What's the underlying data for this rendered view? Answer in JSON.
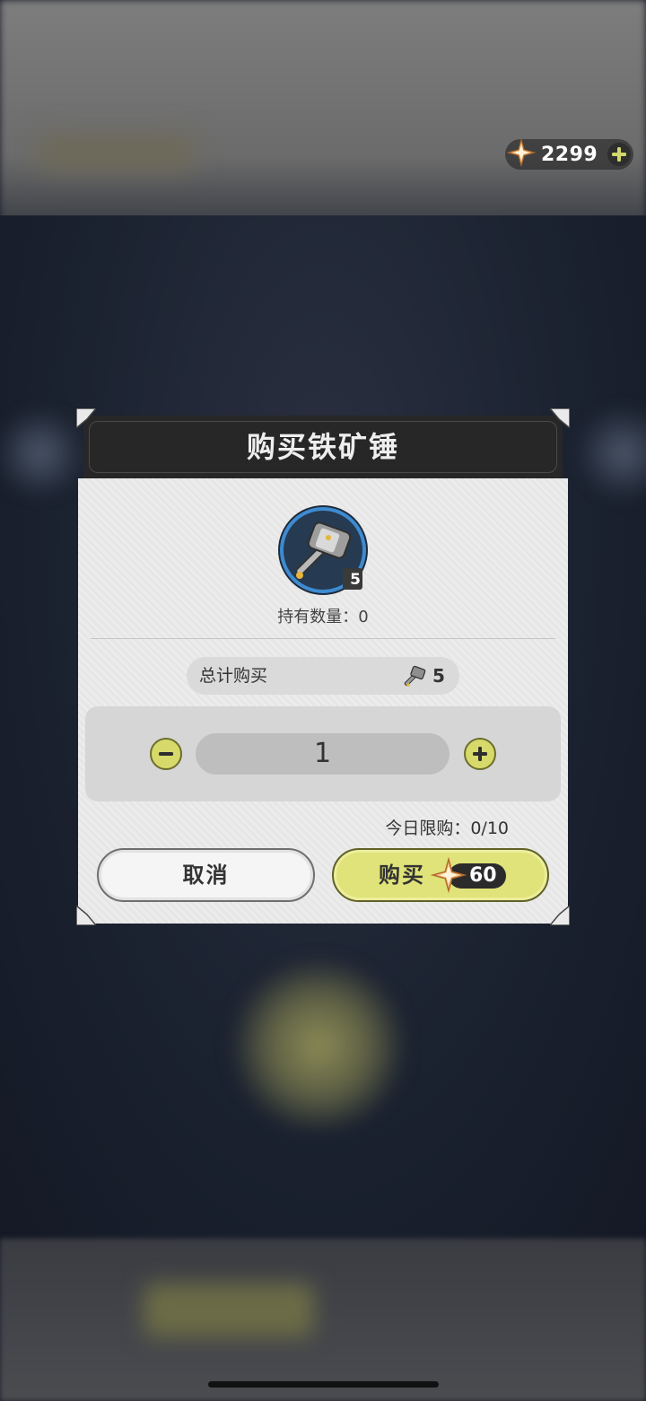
{
  "currency": {
    "value": "2299",
    "icon": "primogem-star-icon",
    "add_icon": "plus-icon"
  },
  "dialog": {
    "title": "购买铁矿锤",
    "item": {
      "icon": "iron-hammer-icon",
      "badge": "5",
      "held_text": "持有数量：0"
    },
    "total": {
      "label": "总计购买",
      "icon": "hammer-icon",
      "count": "5"
    },
    "quantity": {
      "value": "1",
      "minus_icon": "minus-icon",
      "plus_icon": "plus-icon"
    },
    "daily_limit": "今日限购：0/10",
    "cancel_label": "取消",
    "buy_label": "购买",
    "price": "60"
  },
  "colors": {
    "accent_yellow": "#e0e379",
    "header_dark": "#272727",
    "panel_light": "#ececec"
  }
}
